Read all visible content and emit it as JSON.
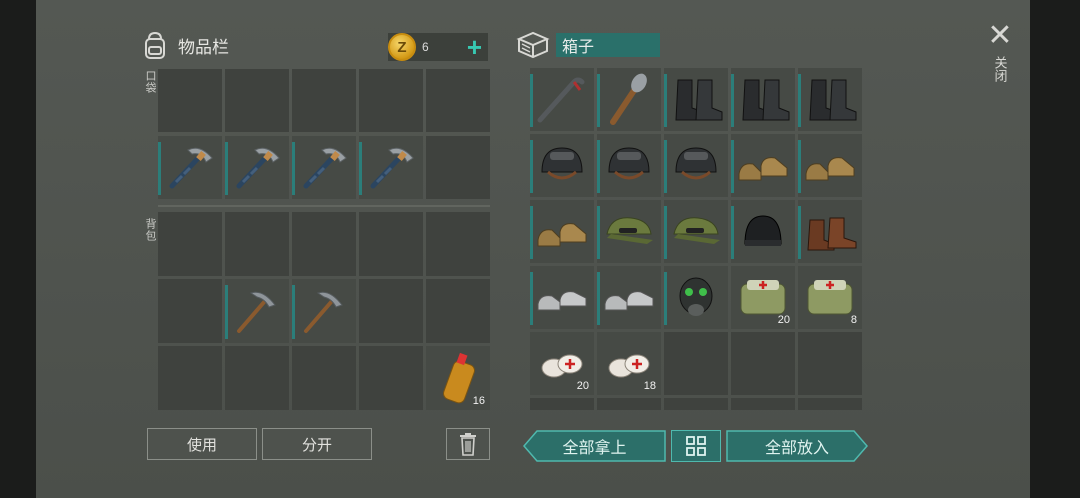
{
  "inventory": {
    "title": "物品栏",
    "pocket_label": "口袋",
    "backpack_label": "背包",
    "coins": "6",
    "coin_symbol": "Z"
  },
  "box": {
    "title": "箱子"
  },
  "buttons": {
    "use": "使用",
    "split": "分开",
    "take_all": "全部拿上",
    "put_all": "全部放入"
  },
  "close": {
    "label": "关闭"
  },
  "pocket_slots": [
    {
      "item": ""
    },
    {
      "item": ""
    },
    {
      "item": ""
    },
    {
      "item": ""
    },
    {
      "item": ""
    },
    {
      "item": "pickaxe"
    },
    {
      "item": "pickaxe"
    },
    {
      "item": "pickaxe"
    },
    {
      "item": "pickaxe"
    },
    {
      "item": ""
    }
  ],
  "backpack_slots": [
    {
      "item": ""
    },
    {
      "item": ""
    },
    {
      "item": ""
    },
    {
      "item": ""
    },
    {
      "item": ""
    },
    {
      "item": ""
    },
    {
      "item": "crude-pickaxe"
    },
    {
      "item": "crude-pickaxe"
    },
    {
      "item": ""
    },
    {
      "item": ""
    },
    {
      "item": ""
    },
    {
      "item": ""
    },
    {
      "item": ""
    },
    {
      "item": ""
    },
    {
      "item": "water-bottle",
      "qty": "16"
    }
  ],
  "box_slots": [
    {
      "item": "crowbar"
    },
    {
      "item": "spiked-club"
    },
    {
      "item": "combat-boots"
    },
    {
      "item": "combat-boots"
    },
    {
      "item": "combat-boots"
    },
    {
      "item": "military-helmet"
    },
    {
      "item": "military-helmet"
    },
    {
      "item": "military-helmet"
    },
    {
      "item": "tan-shoes"
    },
    {
      "item": "tan-shoes"
    },
    {
      "item": "tan-shoes"
    },
    {
      "item": "camo-cap"
    },
    {
      "item": "camo-cap"
    },
    {
      "item": "beanie"
    },
    {
      "item": "brown-boots"
    },
    {
      "item": "sneakers"
    },
    {
      "item": "sneakers"
    },
    {
      "item": "gas-mask"
    },
    {
      "item": "first-aid-bag",
      "qty": "20"
    },
    {
      "item": "first-aid-bag",
      "qty": "8"
    },
    {
      "item": "bandage",
      "qty": "20"
    },
    {
      "item": "bandage",
      "qty": "18"
    },
    {
      "item": ""
    },
    {
      "item": ""
    },
    {
      "item": ""
    }
  ]
}
